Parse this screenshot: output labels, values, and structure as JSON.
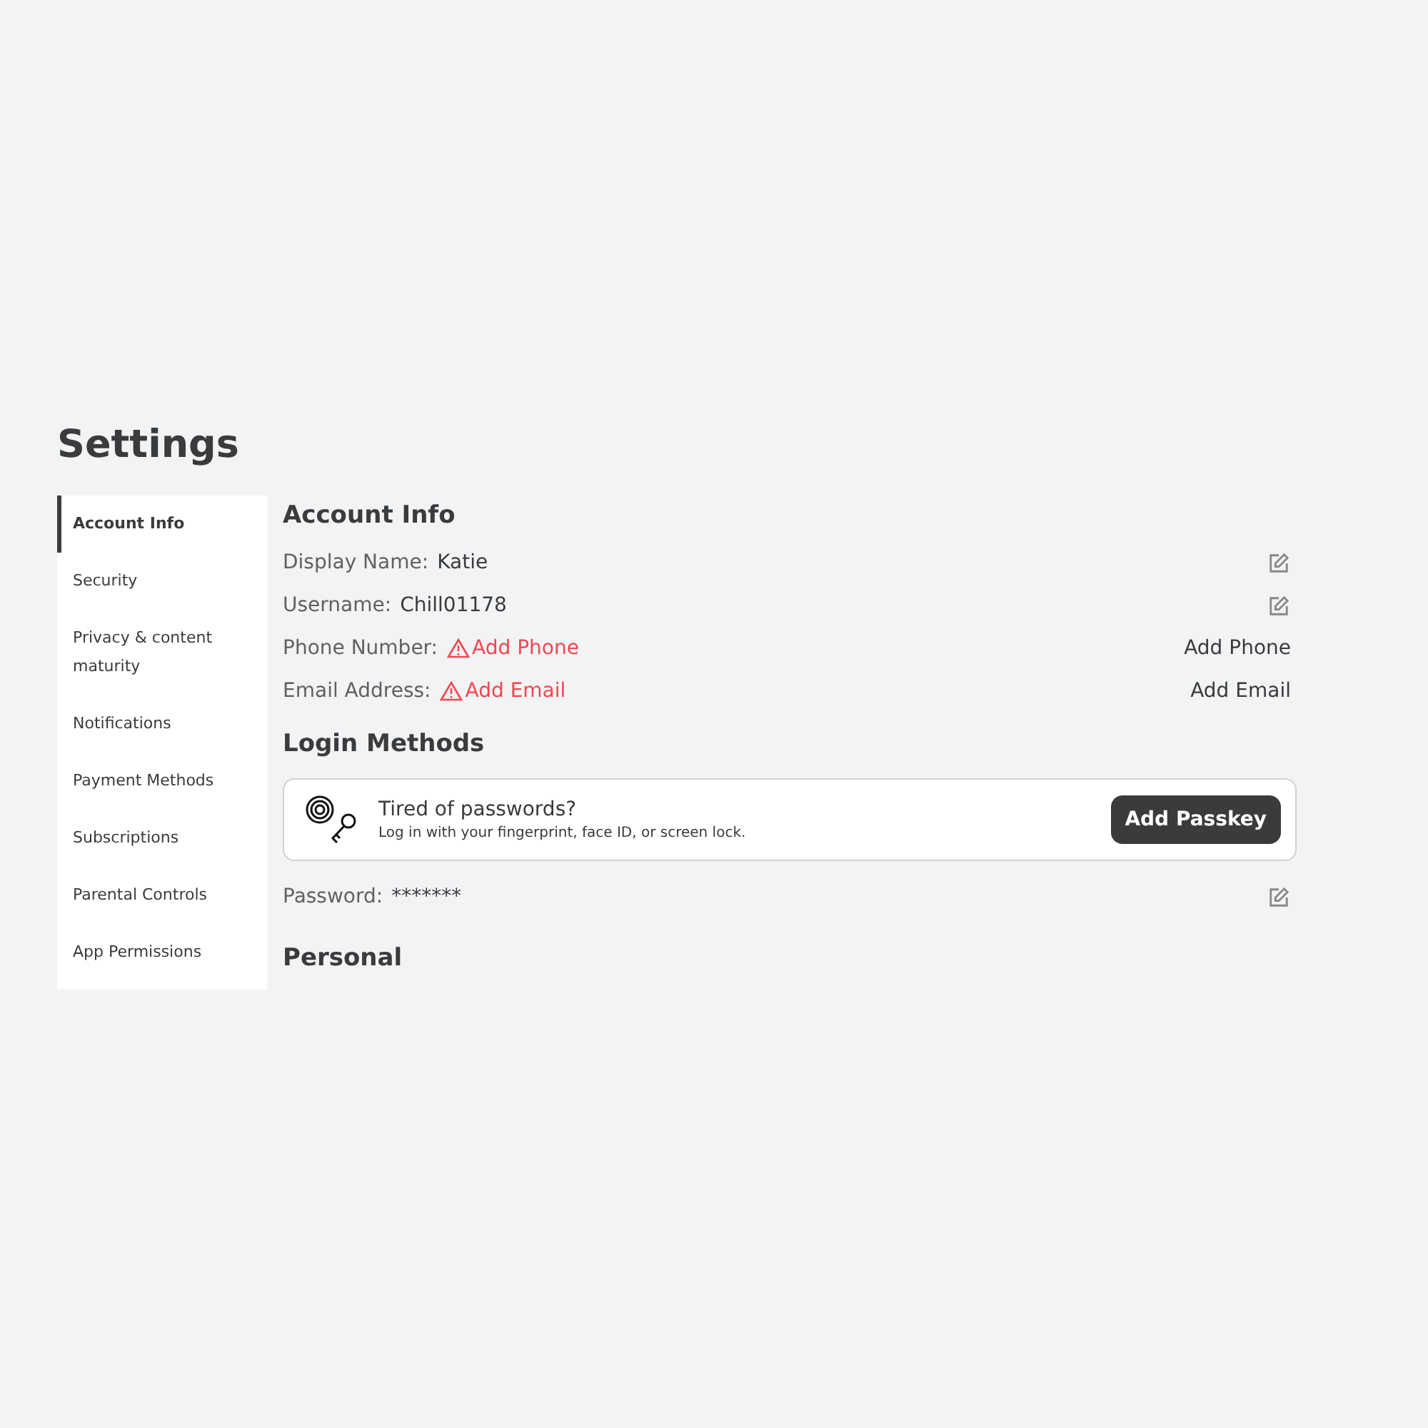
{
  "title": "Settings",
  "sidebar": {
    "items": [
      {
        "label": "Account Info",
        "selected": true
      },
      {
        "label": "Security",
        "selected": false
      },
      {
        "label": "Privacy & content maturity",
        "selected": false
      },
      {
        "label": "Notifications",
        "selected": false
      },
      {
        "label": "Payment Methods",
        "selected": false
      },
      {
        "label": "Subscriptions",
        "selected": false
      },
      {
        "label": "Parental Controls",
        "selected": false
      },
      {
        "label": "App Permissions",
        "selected": false
      }
    ]
  },
  "account_info": {
    "heading": "Account Info",
    "rows": [
      {
        "kind": "edit",
        "label": "Display Name:",
        "value": "Katie"
      },
      {
        "kind": "edit",
        "label": "Username:",
        "value": "Chill01178"
      },
      {
        "kind": "missing",
        "label": "Phone Number:",
        "warning": "Add Phone",
        "action": "Add Phone"
      },
      {
        "kind": "missing",
        "label": "Email Address:",
        "warning": "Add Email",
        "action": "Add Email"
      }
    ]
  },
  "login_methods": {
    "heading": "Login Methods",
    "passkey": {
      "title": "Tired of passwords?",
      "description": "Log in with your fingerprint, face ID, or screen lock.",
      "button": "Add Passkey"
    },
    "rows": [
      {
        "kind": "edit",
        "label": "Password:",
        "value": "*******"
      }
    ]
  },
  "personal": {
    "heading": "Personal"
  }
}
